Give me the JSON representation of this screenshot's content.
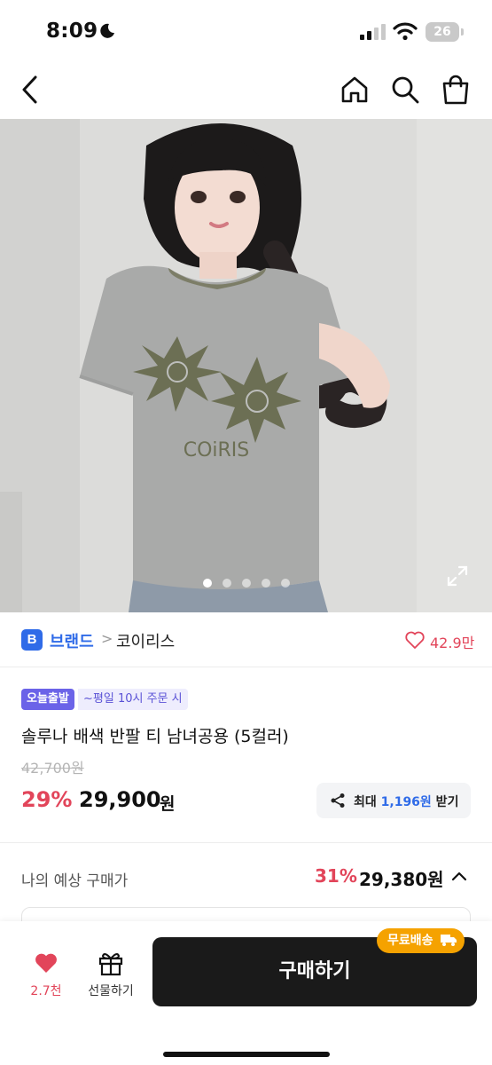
{
  "status_bar": {
    "time": "8:09",
    "battery": "26"
  },
  "nav": {
    "back_icon": "chevron-left-icon",
    "home_icon": "home-icon",
    "search_icon": "search-icon",
    "bag_icon": "shopping-bag-icon"
  },
  "hero": {
    "image_text": "COiRIS",
    "slide_count": 5,
    "active_slide": 1
  },
  "brand": {
    "badge": "B",
    "label": "브랜드",
    "separator": ">",
    "name": "코이리스",
    "like_count": "42.9만"
  },
  "product": {
    "ship_badge": "오늘출발",
    "ship_note": "~평일 10시 주문 시",
    "title": "솔루나 배색 반팔 티 남녀공용 (5컬러)",
    "original_price": "42,700원",
    "discount": "29%",
    "price": "29,900",
    "price_unit": "원",
    "reward_prefix": "최대 ",
    "reward_amount": "1,196원",
    "reward_suffix": " 받기"
  },
  "expected_price": {
    "label": "나의 예상 구매가",
    "discount": "31%",
    "value": "29,380원"
  },
  "bottom_bar": {
    "like_count": "2.7천",
    "gift_label": "선물하기",
    "buy_label": "구매하기",
    "free_shipping": "무료배송"
  },
  "colors": {
    "accent_red": "#e2455a",
    "brand_blue": "#2f6be8",
    "badge_purple": "#6b63e8",
    "free_ship_orange": "#f5a200",
    "buy_button": "#1a1a1a"
  }
}
